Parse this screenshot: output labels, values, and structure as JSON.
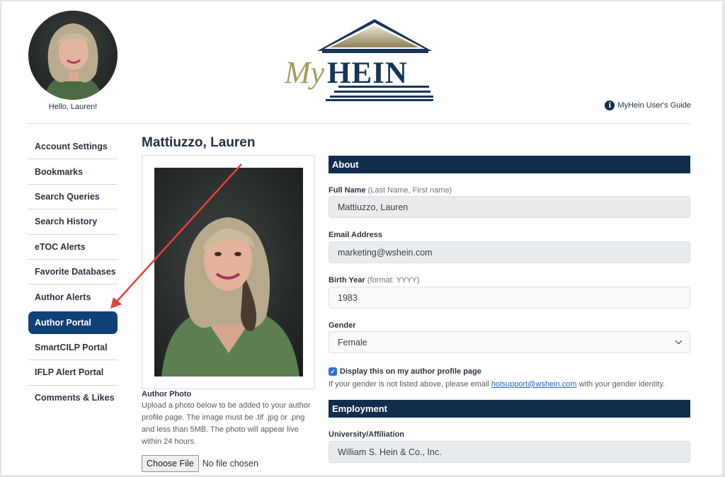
{
  "header": {
    "greeting": "Hello, Lauren!",
    "logo_text_my": "My",
    "logo_text_hein": "HEIN",
    "guide_icon": "info-circle-icon",
    "guide_link": "MyHein User's Guide"
  },
  "sidebar": {
    "items": [
      {
        "label": "Account Settings",
        "active": false
      },
      {
        "label": "Bookmarks",
        "active": false
      },
      {
        "label": "Search Queries",
        "active": false
      },
      {
        "label": "Search History",
        "active": false
      },
      {
        "label": "eTOC Alerts",
        "active": false
      },
      {
        "label": "Favorite Databases",
        "active": false
      },
      {
        "label": "Author Alerts",
        "active": false
      },
      {
        "label": "Author Portal",
        "active": true
      },
      {
        "label": "SmartCILP Portal",
        "active": false
      },
      {
        "label": "IFLP Alert Portal",
        "active": false
      },
      {
        "label": "Comments & Likes",
        "active": false
      }
    ]
  },
  "profile": {
    "name": "Mattiuzzo, Lauren",
    "photo_label": "Author Photo",
    "photo_description": "Upload a photo below to be added to your author profile page. The image must be .tif .jpg or .png and less than 5MB. The photo will appear live within 24 hours.",
    "choose_file_label": "Choose File",
    "file_status": "No file chosen"
  },
  "about": {
    "heading": "About",
    "full_name_label": "Full Name",
    "full_name_hint": "(Last Name, First name)",
    "full_name_value": "Mattiuzzo, Lauren",
    "email_label": "Email Address",
    "email_value": "marketing@wshein.com",
    "birth_year_label": "Birth Year",
    "birth_year_hint": "(format: YYYY)",
    "birth_year_value": "1983",
    "gender_label": "Gender",
    "gender_value": "Female",
    "display_checkbox_label": "Display this on my author profile page",
    "display_checked": true,
    "note_prefix": "If your gender is not listed above, please email ",
    "note_email": "holsupport@wshein.com",
    "note_suffix": " with your gender identity."
  },
  "employment": {
    "heading": "Employment",
    "affiliation_label": "University/Affiliation",
    "affiliation_value": "William S. Hein & Co., Inc."
  },
  "colors": {
    "navy": "#132d4f",
    "active_nav": "#0f4177",
    "logo_gold": "#a89a5e",
    "annotation_arrow": "#e8413c",
    "link": "#2a62c4"
  }
}
